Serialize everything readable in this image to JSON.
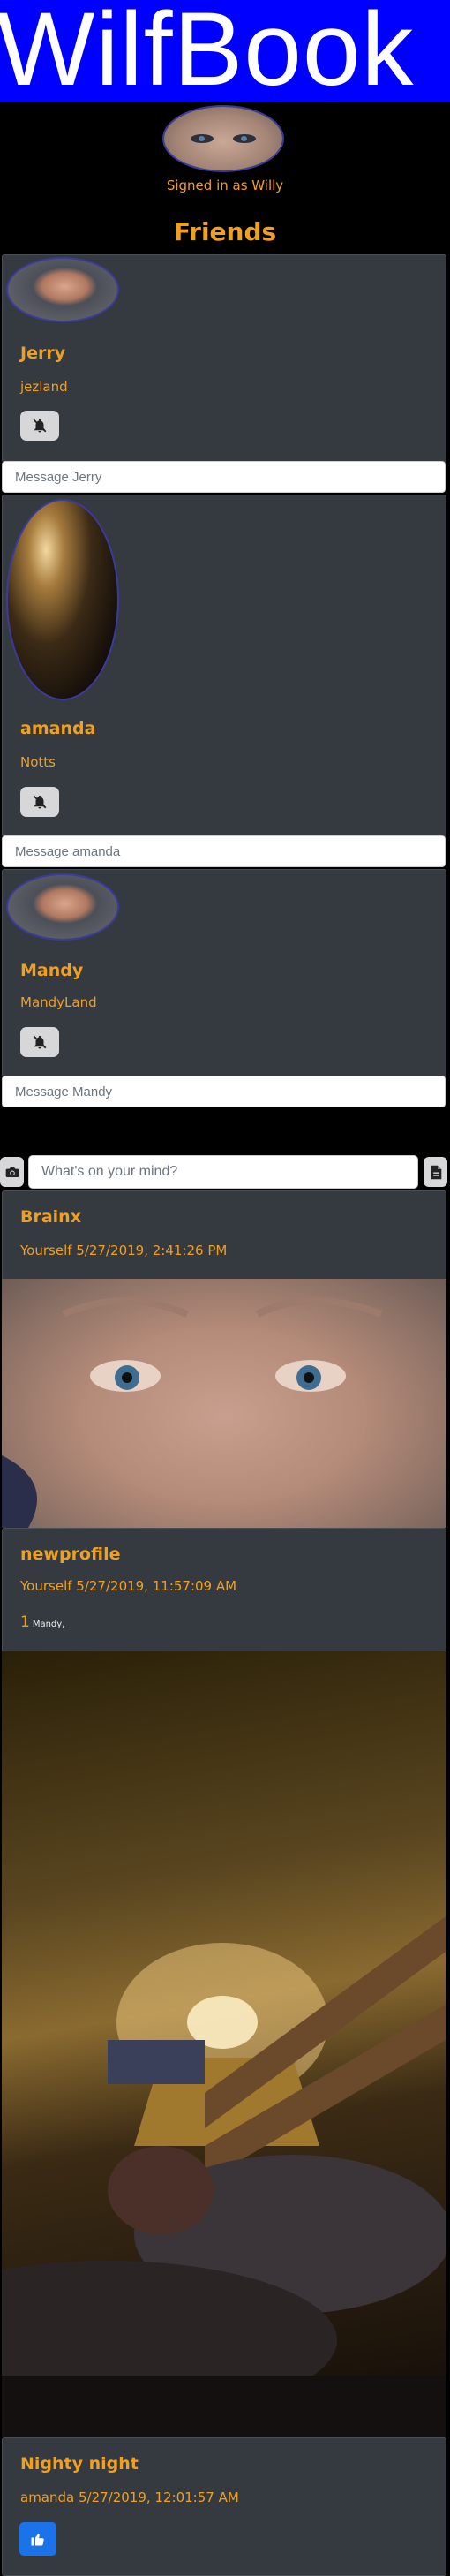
{
  "app": {
    "brand": "WilfBook",
    "signed_in": "Signed in as Willy"
  },
  "friends": {
    "heading": "Friends",
    "items": [
      {
        "name": "Jerry",
        "location": "jezland",
        "message_placeholder": "Message Jerry",
        "avatar": "face-photo"
      },
      {
        "name": "amanda",
        "location": "Notts",
        "message_placeholder": "Message amanda",
        "avatar": "bedroom-photo"
      },
      {
        "name": "Mandy",
        "location": "MandyLand",
        "message_placeholder": "Message Mandy",
        "avatar": "face-photo"
      }
    ]
  },
  "composer": {
    "placeholder": "What's on your mind?",
    "photo_icon": "camera-icon",
    "file_icon": "file-icon"
  },
  "posts": [
    {
      "title": "Brainx",
      "meta": "Yourself 5/27/2019, 2:41:26 PM"
    },
    {
      "title": "newprofile",
      "meta": "Yourself 5/27/2019, 11:57:09 AM",
      "like_count": "1",
      "liked_by": "Mandy,"
    },
    {
      "title": "Nighty night",
      "meta": "amanda 5/27/2019, 12:01:57 AM"
    }
  ],
  "colors": {
    "accent": "#f0a020",
    "brand_bar": "#0000ff",
    "panel": "#343a40",
    "like_button": "#1a73e8"
  }
}
